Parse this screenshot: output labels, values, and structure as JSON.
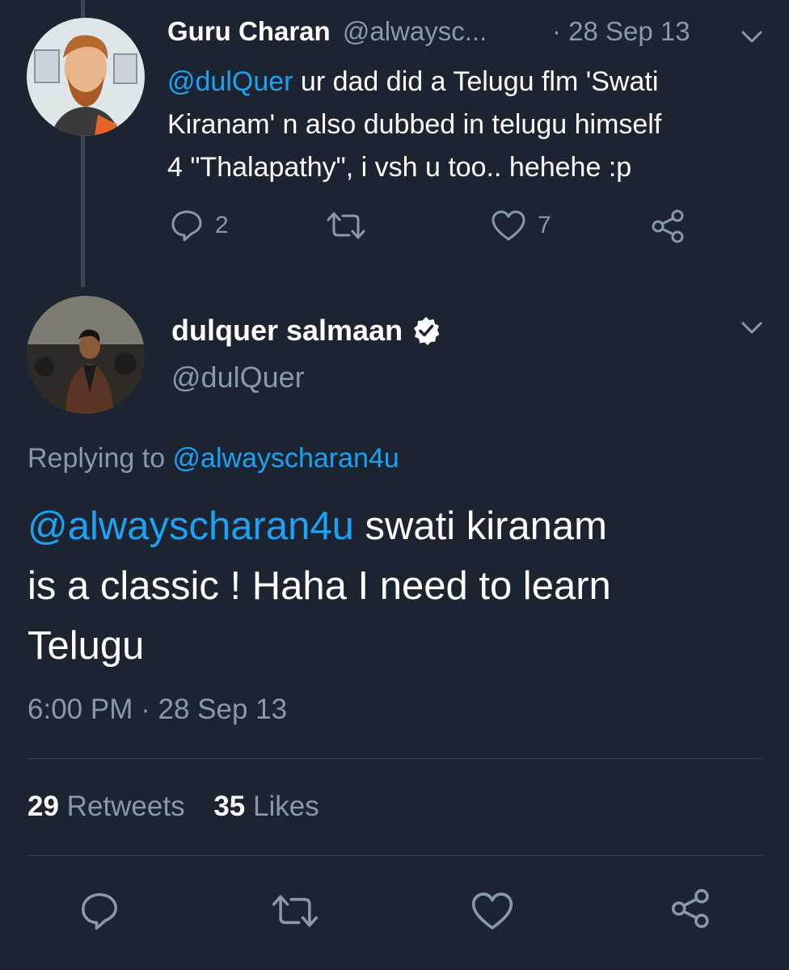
{
  "parent_tweet": {
    "display_name": "Guru Charan",
    "handle": "@alwaysc...",
    "separator": "·",
    "date": "28 Sep 13",
    "mention": "@dulQuer",
    "text_line1": " ur dad did a Telugu flm 'Swati",
    "text_line2": "Kiranam' n also dubbed in telugu himself",
    "text_line3": "4 \"Thalapathy\", i vsh u too.. hehehe :p",
    "reply_count": "2",
    "like_count": "7"
  },
  "main_tweet": {
    "display_name": "dulquer salmaan",
    "handle": "@dulQuer",
    "replying_prefix": "Replying to ",
    "replying_handle": "@alwayscharan4u",
    "mention": "@alwayscharan4u",
    "text_line1_rest": " swati kiranam",
    "text_line2": "is a classic ! Haha I need to learn",
    "text_line3": "Telugu",
    "time": "6:00 PM",
    "separator": "·",
    "date": "28 Sep 13",
    "retweet_count": "29",
    "retweet_label": "Retweets",
    "like_count": "35",
    "like_label": "Likes"
  },
  "colors": {
    "background": "#1b2430",
    "link": "#1da1f2",
    "muted": "#8b98a5",
    "text": "#ffffff"
  }
}
